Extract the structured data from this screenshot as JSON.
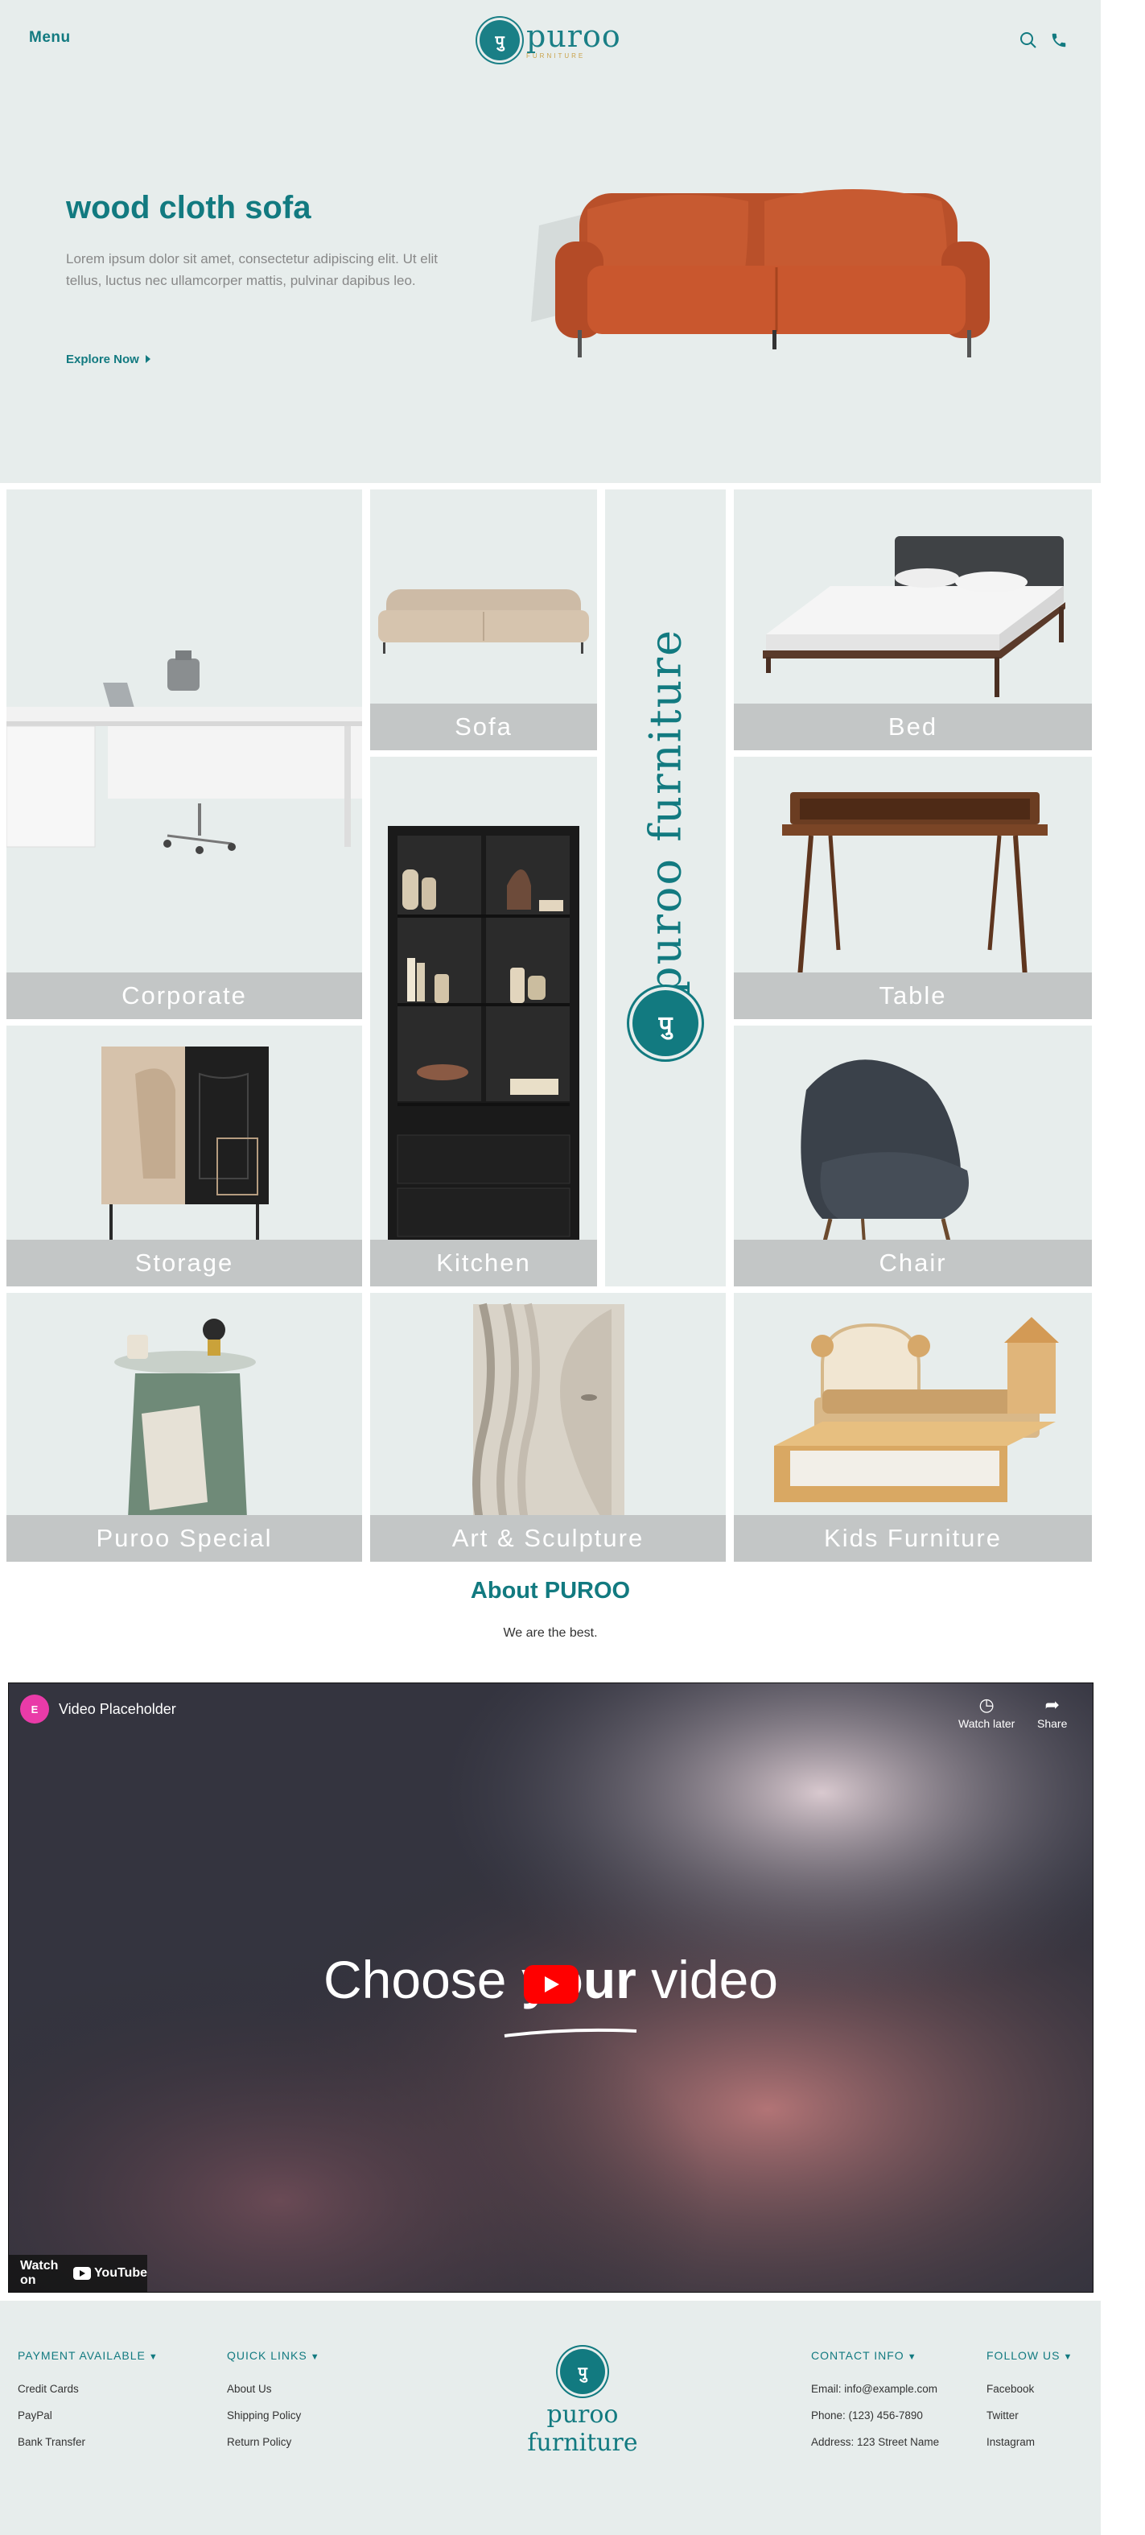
{
  "header": {
    "menu_label": "Menu",
    "logo_badge": "पु",
    "logo_word": "puroo",
    "logo_tagline": "FURNITURE",
    "search_icon": "search-icon",
    "phone_icon": "phone-icon"
  },
  "hero": {
    "title": "wood cloth sofa",
    "text": "Lorem ipsum dolor sit amet, consectetur adipiscing elit. Ut elit tellus, luctus nec ullamcorper mattis, pulvinar dapibus leo.",
    "cta": "Explore Now"
  },
  "categories": {
    "corporate": "Corporate",
    "sofa": "Sofa",
    "bed": "Bed",
    "table": "Table",
    "storage": "Storage",
    "kitchen": "Kitchen",
    "chair": "Chair",
    "puroo_special": "Puroo Special",
    "art": "Art & Sculpture",
    "kids": "Kids Furniture"
  },
  "brand_column": {
    "text": "puroo furniture",
    "badge": "पु"
  },
  "about": {
    "title": "About PUROO",
    "subtitle": "We are the best."
  },
  "video": {
    "badge": "E",
    "title": "Video Placeholder",
    "watch_later": "Watch later",
    "share": "Share",
    "center_pre": "Choose ",
    "center_bold": "your",
    "center_post": " video",
    "watch_on": "Watch on",
    "youtube": "YouTube"
  },
  "footer": {
    "payment": {
      "heading": "PAYMENT AVAILABLE",
      "items": [
        "Credit Cards",
        "PayPal",
        "Bank Transfer"
      ]
    },
    "quick_links": {
      "heading": "QUICK LINKS",
      "items": [
        "About Us",
        "Shipping Policy",
        "Return Policy"
      ]
    },
    "logo_badge": "पु",
    "logo_word": "puroo furniture",
    "contact": {
      "heading": "CONTACT INFO",
      "items": [
        "Email: info@example.com",
        "Phone: (123) 456-7890",
        "Address: 123 Street Name"
      ]
    },
    "follow": {
      "heading": "FOLLOW US",
      "items": [
        "Facebook",
        "Twitter",
        "Instagram"
      ]
    }
  },
  "colors": {
    "brand_teal": "#127a80",
    "panel_bg": "#e7edec",
    "caption_bar": "#c3c6c6",
    "sofa_orange": "#c9572e"
  }
}
